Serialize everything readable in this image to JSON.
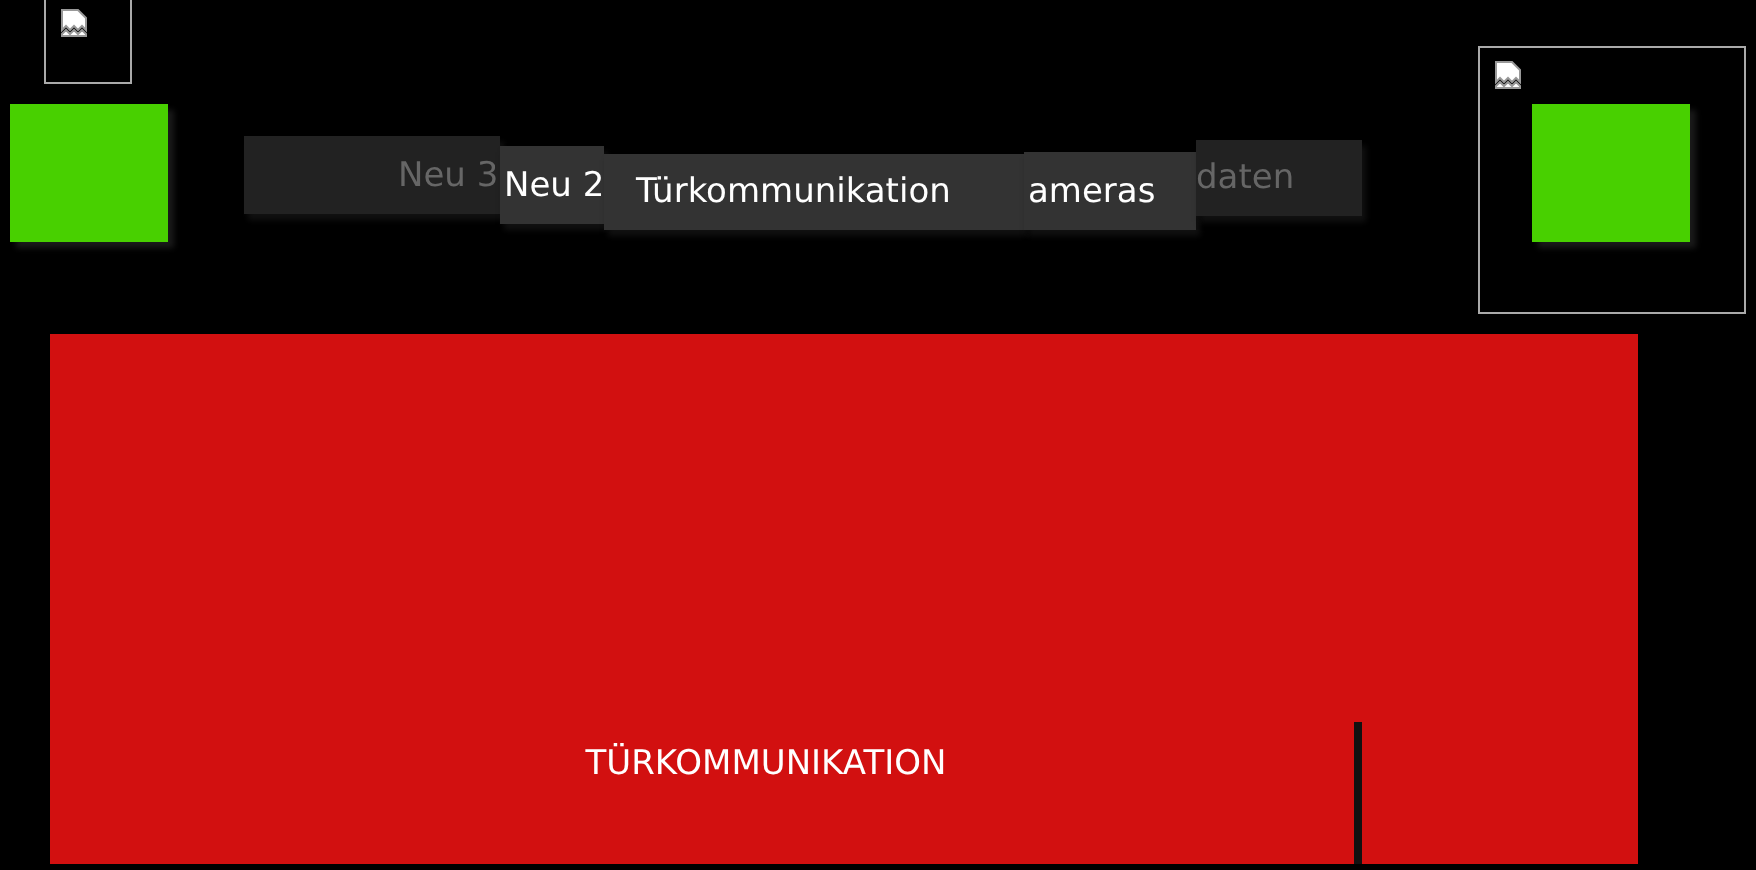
{
  "tabs": [
    {
      "label": "Neu 3",
      "dimmed": true
    },
    {
      "label": "Neu 2",
      "dimmed": false
    },
    {
      "label": "Türkommunikation",
      "dimmed": false
    },
    {
      "label": "ameras",
      "dimmed": false
    },
    {
      "label": "daten",
      "dimmed": true
    }
  ],
  "panel": {
    "title": "TÜRKOMMUNIKATION"
  }
}
